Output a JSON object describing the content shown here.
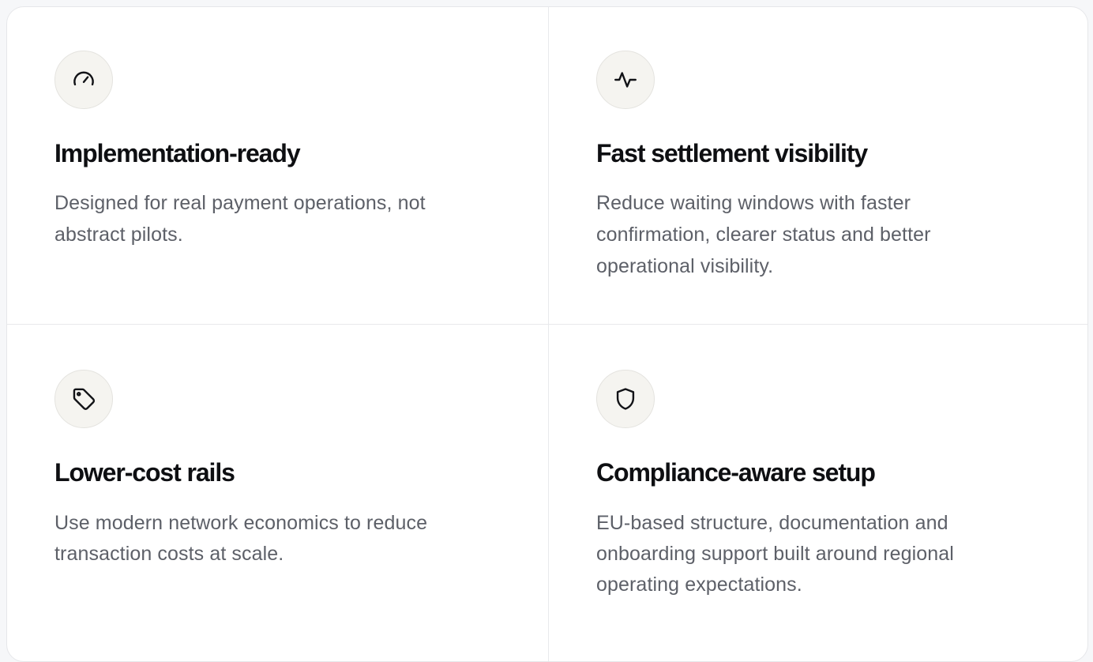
{
  "features": [
    {
      "icon": "gauge-icon",
      "title": "Implementation-ready",
      "description_lines": [
        "Designed for real payment operations, not",
        "abstract pilots."
      ]
    },
    {
      "icon": "activity-pulse-icon",
      "title": "Fast settlement visibility",
      "description_lines": [
        "Reduce waiting windows with faster",
        "confirmation, clearer status and better",
        "operational visibility."
      ]
    },
    {
      "icon": "tag-icon",
      "title": "Lower-cost rails",
      "description_lines": [
        "Use modern network economics to reduce",
        "transaction costs at scale."
      ]
    },
    {
      "icon": "shield-icon",
      "title": "Compliance-aware setup",
      "description_lines": [
        "EU-based structure, documentation and",
        "onboarding support built around regional",
        "operating expectations."
      ]
    }
  ],
  "colors": {
    "title": "#0e0f12",
    "description": "#5d6068",
    "icon_bg": "#f5f4f0",
    "border": "#e8e9ec"
  }
}
